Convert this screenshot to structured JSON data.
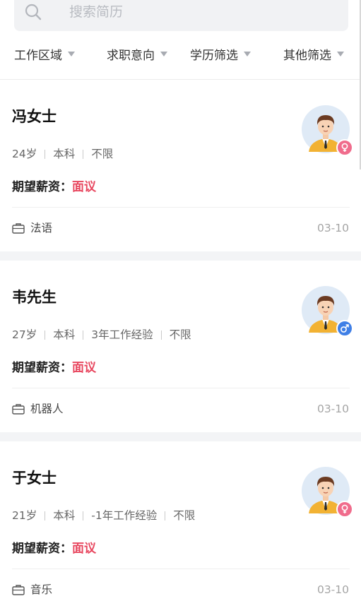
{
  "search": {
    "placeholder": "搜索简历"
  },
  "filters": [
    {
      "label": "工作区域"
    },
    {
      "label": "求职意向"
    },
    {
      "label": "学历筛选"
    },
    {
      "label": "其他筛选"
    }
  ],
  "candidates": [
    {
      "name": "冯女士",
      "age": "24岁",
      "education": "本科",
      "experience": "",
      "salary_expect": "不限",
      "salary_label": "期望薪资：",
      "salary_value": "面议",
      "job": "法语",
      "date": "03-10",
      "gender": "female",
      "gender_icon": "female-icon"
    },
    {
      "name": "韦先生",
      "age": "27岁",
      "education": "本科",
      "experience": "3年工作经验",
      "salary_expect": "不限",
      "salary_label": "期望薪资：",
      "salary_value": "面议",
      "job": "机器人",
      "date": "03-10",
      "gender": "male",
      "gender_icon": "male-icon"
    },
    {
      "name": "于女士",
      "age": "21岁",
      "education": "本科",
      "experience": "-1年工作经验",
      "salary_expect": "不限",
      "salary_label": "期望薪资：",
      "salary_value": "面议",
      "job": "音乐",
      "date": "03-10",
      "gender": "female",
      "gender_icon": "female-icon"
    }
  ],
  "colors": {
    "accent_red": "#e8475f",
    "female_badge": "#f06c8c",
    "male_badge": "#3f7fe6"
  }
}
